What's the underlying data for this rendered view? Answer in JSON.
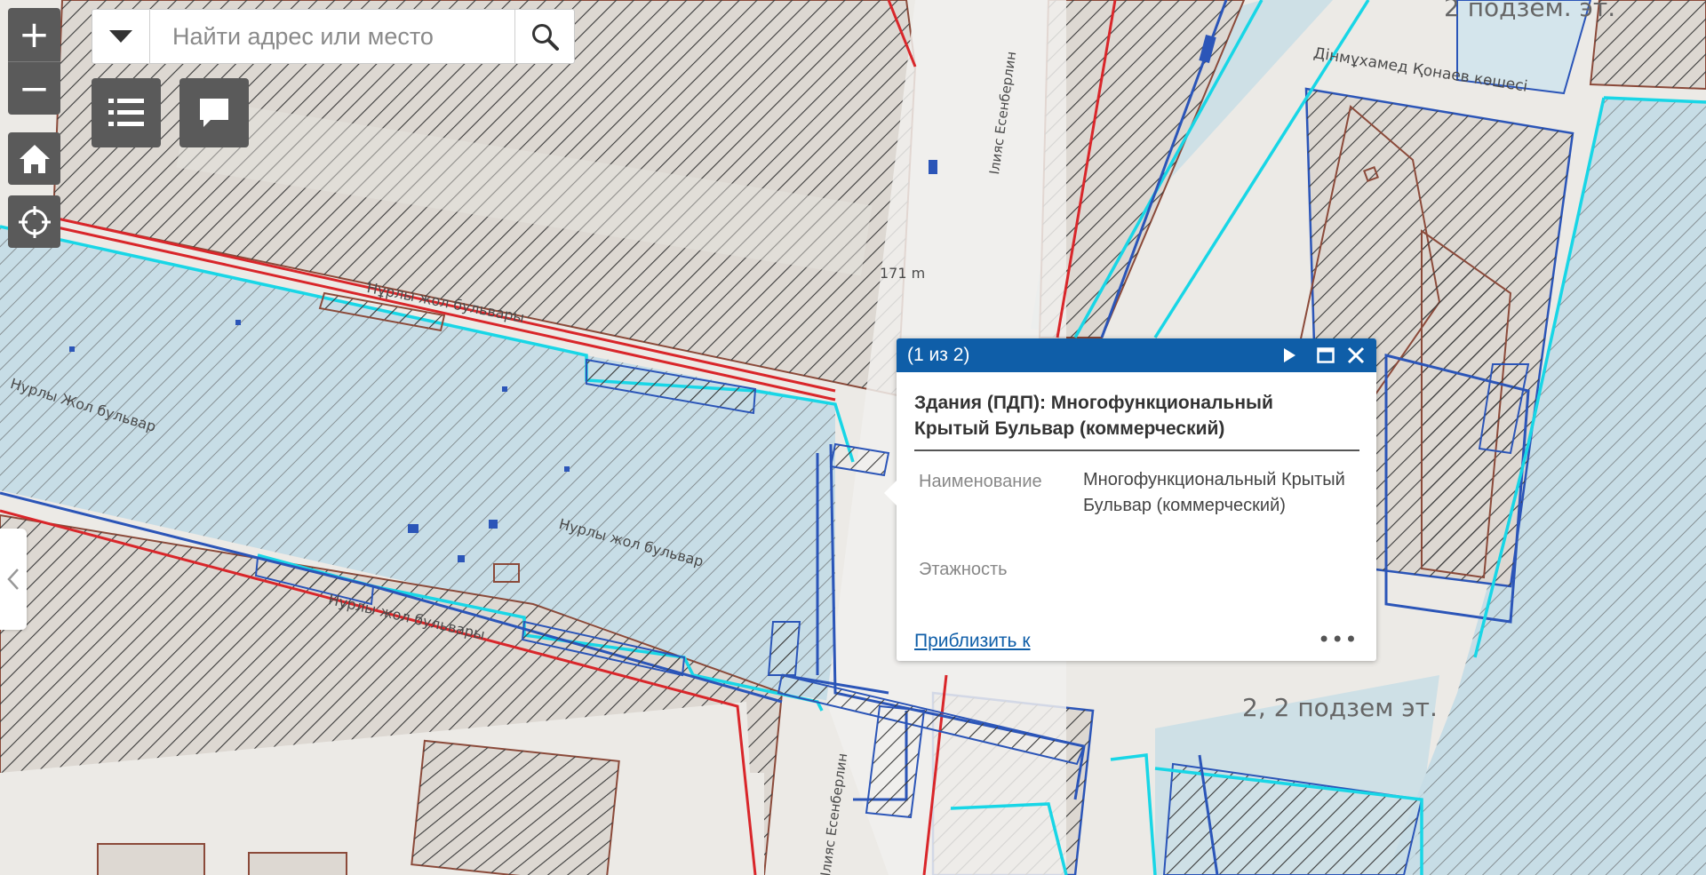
{
  "map": {
    "labels": {
      "street_kunaev": "Дінмұхамед Қонаев көшесі",
      "street_top_left": "Нұрлы жол бульвары",
      "street_left": "Нурлы Жол бульвар",
      "street_mid": "Нурлы жол бульвар",
      "street_lower": "Нурлы жол бульвары",
      "street_vertical_top": "Ілияс Есенберлин",
      "street_vertical_bottom": "Ілияс Есенберлин",
      "measure": "171 m",
      "floors_top_right": "2 подзем. эт.",
      "floors_bottom_right": "2, 2 подзем эт."
    },
    "colors": {
      "background": "#eceae6",
      "hatch": "#3a3a3a",
      "building_outline": "#8b4a3a",
      "red_line": "#d9262a",
      "cyan_line": "#18d6e6",
      "blue_line": "#2b55b8",
      "blue_fill": "#c7dde6"
    }
  },
  "controls": {
    "zoom_in": "+",
    "zoom_out": "−",
    "home_icon": "home-icon",
    "locate_icon": "locate-icon"
  },
  "search": {
    "placeholder": "Найти адрес или место",
    "dropdown_icon": "caret-down-icon",
    "search_icon": "search-icon"
  },
  "toolbar": {
    "layers_icon": "list-icon",
    "comment_icon": "comment-icon"
  },
  "popup": {
    "counter": "(1 из 2)",
    "title": "Здания (ПДП): Многофункциональный Крытый Бульвар (коммерческий)",
    "attributes": [
      {
        "name": "Наименование",
        "value": "Многофункциональный Крытый Бульвар (коммерческий)"
      },
      {
        "name": "Этажность",
        "value": ""
      }
    ],
    "zoom_link": "Приблизить к",
    "more": "•••",
    "header_color": "#0f5ea8"
  }
}
